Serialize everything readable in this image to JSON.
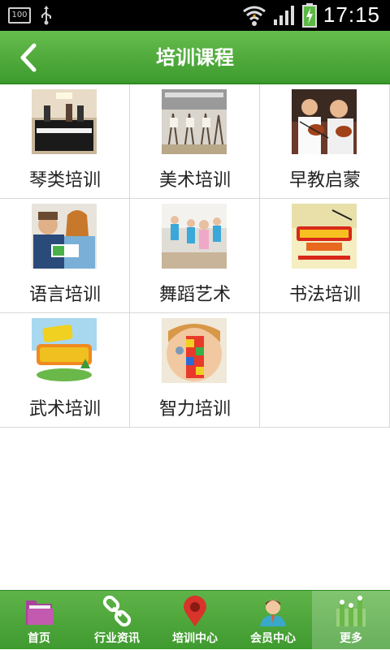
{
  "status_bar": {
    "battery_left": "100",
    "time": "17:15"
  },
  "app_bar": {
    "title": "培训课程"
  },
  "courses": [
    {
      "label": "琴类培训",
      "icon": "piano-photo"
    },
    {
      "label": "美术培训",
      "icon": "art-studio-photo"
    },
    {
      "label": "早教启蒙",
      "icon": "violin-photo"
    },
    {
      "label": "语言培训",
      "icon": "language-class-photo"
    },
    {
      "label": "舞蹈艺术",
      "icon": "ballet-photo"
    },
    {
      "label": "书法培训",
      "icon": "calligraphy-banner"
    },
    {
      "label": "武术培训",
      "icon": "martial-arts-banner"
    },
    {
      "label": "智力培训",
      "icon": "blocks-child-photo"
    }
  ],
  "tabs": [
    {
      "label": "首页",
      "icon": "home-icon"
    },
    {
      "label": "行业资讯",
      "icon": "link-icon"
    },
    {
      "label": "培训中心",
      "icon": "map-pin-icon"
    },
    {
      "label": "会员中心",
      "icon": "member-icon"
    },
    {
      "label": "更多",
      "icon": "more-icon",
      "active": true
    }
  ],
  "colors": {
    "brand_green": "#4aa83a",
    "grid_border": "#d8d8d8"
  }
}
